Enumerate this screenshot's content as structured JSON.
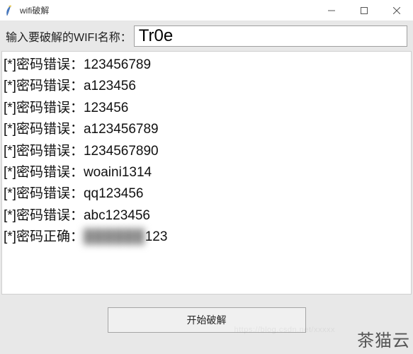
{
  "window": {
    "title": "wifi破解"
  },
  "input": {
    "label": "输入要破解的WIFI名称：",
    "value": "Tr0e"
  },
  "output": {
    "wrong_prefix": "[*]密码错误：",
    "correct_prefix": "[*]密码正确：",
    "lines": [
      {
        "status": "wrong",
        "password": "123456789"
      },
      {
        "status": "wrong",
        "password": "a123456"
      },
      {
        "status": "wrong",
        "password": "123456"
      },
      {
        "status": "wrong",
        "password": "a123456789"
      },
      {
        "status": "wrong",
        "password": "1234567890"
      },
      {
        "status": "wrong",
        "password": "woaini1314"
      },
      {
        "status": "wrong",
        "password": "qq123456"
      },
      {
        "status": "wrong",
        "password": "abc123456"
      },
      {
        "status": "correct",
        "password_hidden": "██████",
        "password_visible": "123"
      }
    ]
  },
  "button": {
    "start_label": "开始破解"
  },
  "watermark": {
    "right": "茶猫云",
    "faint": "https://blog.csdn.net/xxxxx"
  }
}
